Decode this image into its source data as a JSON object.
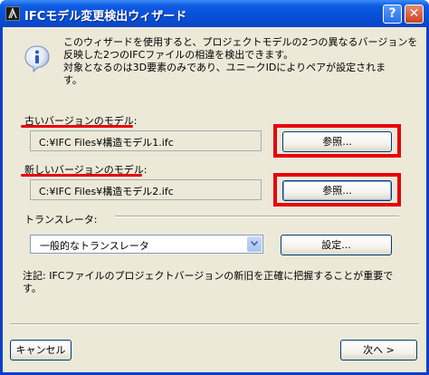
{
  "window": {
    "title": "IFCモデル変更検出ウィザード",
    "help_glyph": "?",
    "close_glyph": "✕"
  },
  "intro": {
    "lines": [
      "このウィザードを使用すると、プロジェクトモデルの2つの異なるバージョンを",
      "反映した2つのIFCファイルの相違を検出できます。",
      "対象となるのは3D要素のみであり、ユニークIDによりペアが設定されま",
      "す。"
    ]
  },
  "old_model": {
    "label": "古いバージョンのモデル:",
    "path": "C:¥IFC Files¥構造モデル1.ifc",
    "browse_label": "参照..."
  },
  "new_model": {
    "label": "新しいバージョンのモデル:",
    "path": "C:¥IFC Files¥構造モデル2.ifc",
    "browse_label": "参照..."
  },
  "translator": {
    "label": "トランスレータ:",
    "selected": "一般的なトランスレータ",
    "settings_label": "設定..."
  },
  "note": {
    "lines": [
      "注記: IFCファイルのプロジェクトバージョンの新旧を正確に把握することが重要で",
      "す。"
    ]
  },
  "footer": {
    "cancel_label": "キャンセル",
    "next_label": "次へ >"
  },
  "colors": {
    "highlight_red": "#e8000c",
    "titlebar_blue": "#0750d8",
    "dialog_bg": "#ece9d8"
  },
  "icons": [
    "app-icon",
    "help-icon",
    "close-icon",
    "info-icon",
    "chevron-down-icon"
  ]
}
